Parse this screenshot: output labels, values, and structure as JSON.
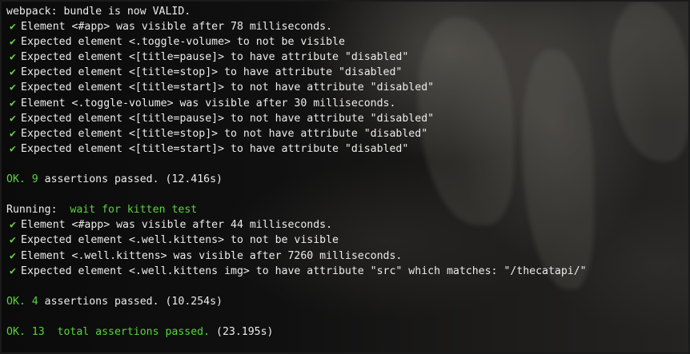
{
  "terminal": {
    "header": "webpack: bundle is now VALID.",
    "suite1": {
      "assertions": [
        "Element <#app> was visible after 78 milliseconds.",
        "Expected element <.toggle-volume> to not be visible",
        "Expected element <[title=pause]> to have attribute \"disabled\"",
        "Expected element <[title=stop]> to have attribute \"disabled\"",
        "Expected element <[title=start]> to not have attribute \"disabled\"",
        "Element <.toggle-volume> was visible after 30 milliseconds.",
        "Expected element <[title=pause]> to not have attribute \"disabled\"",
        "Expected element <[title=stop]> to not have attribute \"disabled\"",
        "Expected element <[title=start]> to have attribute \"disabled\""
      ],
      "summary_ok": "OK. 9",
      "summary_rest": " assertions passed. (12.416s)"
    },
    "suite2": {
      "running_label": "Running:",
      "running_name": "  wait for kitten test",
      "assertions": [
        "Element <#app> was visible after 44 milliseconds.",
        "Expected element <.well.kittens> to not be visible",
        "Element <.well.kittens> was visible after 7260 milliseconds.",
        "Expected element <.well.kittens img> to have attribute \"src\" which matches: \"/thecatapi/\""
      ],
      "summary_ok": "OK. 4",
      "summary_rest": " assertions passed. (10.254s)"
    },
    "total": {
      "ok_part": "OK. 13  total assertions passed.",
      "time_part": " (23.195s)"
    },
    "check_glyph": "✔",
    "colors": {
      "check": "#6fd14b",
      "ok": "#56d63a",
      "text": "#ececec"
    }
  }
}
